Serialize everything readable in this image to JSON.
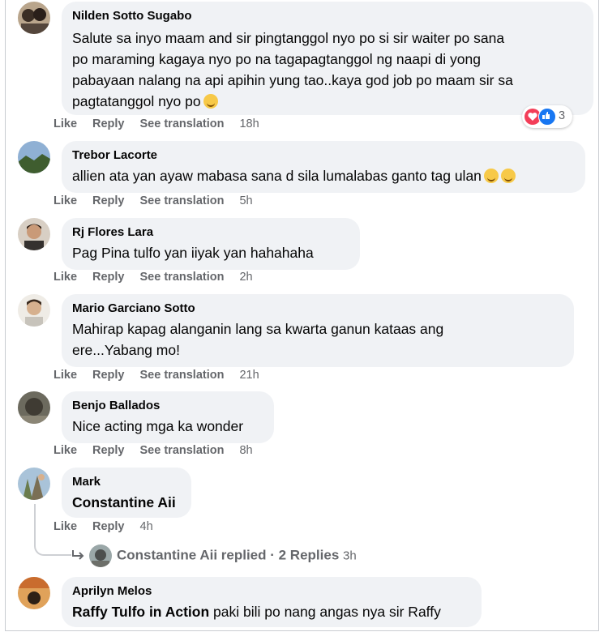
{
  "actions": {
    "like": "Like",
    "reply": "Reply",
    "see_translation": "See translation"
  },
  "comments": [
    {
      "name": "Nilden Sotto Sugabo",
      "lines": [
        "Salute sa inyo maam and sir pingtanggol nyo po si sir waiter po sana",
        "po maraming kagaya nyo po na tagapagtanggol ng naapi di yong",
        "pabayaan nalang na api apihin yung tao..kaya god job po maam sir sa",
        "pagtatanggol nyo po"
      ],
      "time": "18h",
      "reaction_count": "3"
    },
    {
      "name": "Trebor Lacorte",
      "lines": [
        "allien ata yan ayaw mabasa sana d sila lumalabas ganto tag ulan"
      ],
      "time": "5h"
    },
    {
      "name": "Rj Flores Lara",
      "lines": [
        "Pag Pina tulfo yan iiyak yan hahahaha"
      ],
      "time": "2h"
    },
    {
      "name": "Mario Garciano Sotto",
      "lines": [
        "Mahirap kapag alanganin lang sa kwarta ganun kataas ang",
        "ere...Yabang mo!"
      ],
      "time": "21h"
    },
    {
      "name": "Benjo Ballados",
      "lines": [
        "Nice acting mga ka wonder"
      ],
      "time": "8h"
    },
    {
      "name": "Mark",
      "tag": "Constantine Aii",
      "time": "4h",
      "replies": {
        "author": "Constantine Aii",
        "summary": "replied · 2 Replies",
        "time": "3h"
      }
    },
    {
      "name": "Aprilyn Melos",
      "tag": "Raffy Tulfo in Action",
      "text": " paki bili po nang angas nya sir Raffy"
    }
  ]
}
